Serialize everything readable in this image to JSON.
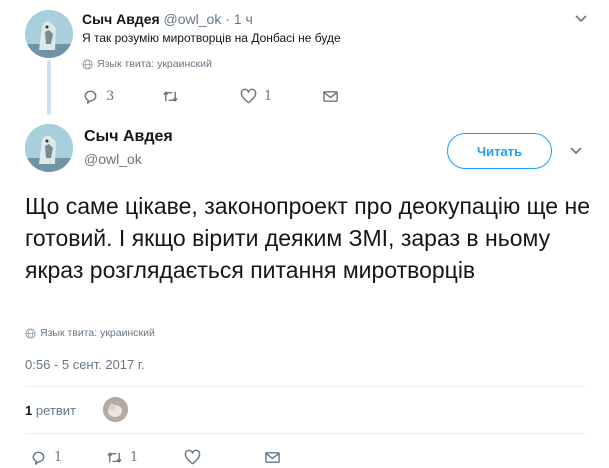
{
  "parent": {
    "name": "Сыч Авдея",
    "handle": "@owl_ok",
    "separator": "·",
    "time": "1 ч",
    "text": "Я так розумію миротворців на Донбасі не буде",
    "lang": "Язык твита: украинский",
    "reply_count": "3",
    "retweet_count": "",
    "like_count": "1"
  },
  "main": {
    "name": "Сыч Авдея",
    "handle": "@owl_ok",
    "follow_label": "Читать",
    "text": "Що саме цікаве, законопроект про деокупацію ще не готовий. І якщо вірити деяким ЗМІ, зараз в ньому якраз розглядається питання миротворців",
    "lang": "Язык твита: украинский",
    "timestamp": "0:56 - 5 сент. 2017 г.",
    "retweets_number": "1",
    "retweets_label": "ретвит",
    "reply_count": "1",
    "retweet_count": "1",
    "like_count": ""
  },
  "icons": {
    "reply": "reply-icon",
    "retweet": "retweet-icon",
    "like": "heart-icon",
    "dm": "envelope-icon",
    "globe": "globe-icon",
    "chevron": "chevron-down-icon"
  },
  "colors": {
    "accent": "#1da1f2",
    "text": "#14171a",
    "muted": "#657786",
    "thread_line": "#cde3ec"
  }
}
